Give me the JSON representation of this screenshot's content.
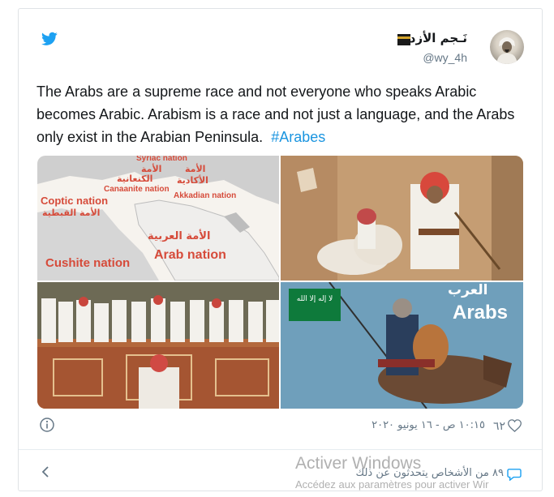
{
  "tweet": {
    "display_name": "نَـجم الأزدي",
    "handle": "@wy_4h",
    "text": "The Arabs are a supreme race and not everyone who speaks Arabic becomes Arabic. Arabism is a race and not just a language, and the Arabs only exist in the Arabian Peninsula.",
    "hashtag": "#Arabes",
    "like_count": "٦٢",
    "timestamp": "١٠:١٥ ص - ١٦ يونيو ٢٠٢٠",
    "talking_count": "٨٩ من الأشخاص يتحدثون عن ذلك"
  },
  "media": {
    "map_labels": {
      "syriac_nation": "Syriac nation",
      "syriac_arabic": "الأمة",
      "canaanite_arabic": "الكنعانية",
      "canaanite": "Canaanite nation",
      "akkadian_arabic_1": "الأمة",
      "akkadian_arabic_2": "الأكادية",
      "akkadian": "Akkadian nation",
      "coptic": "Coptic nation",
      "coptic_arabic": "الأمة القبطية",
      "arab_arabic": "الأمة العربية",
      "arab": "Arab nation",
      "cushite": "Cushite nation"
    },
    "poster_arabic": "العرب",
    "poster_english": "Arabs",
    "flag_text": "لا إله إلا الله"
  },
  "watermark": {
    "line1": "Activer Windows",
    "line2": "Accédez aux paramètres pour activer Wir"
  },
  "colors": {
    "twitter_blue": "#1da1f2",
    "hashtag_blue": "#1b95e0",
    "secondary_text": "#657786",
    "map_red": "#d64b3a"
  }
}
